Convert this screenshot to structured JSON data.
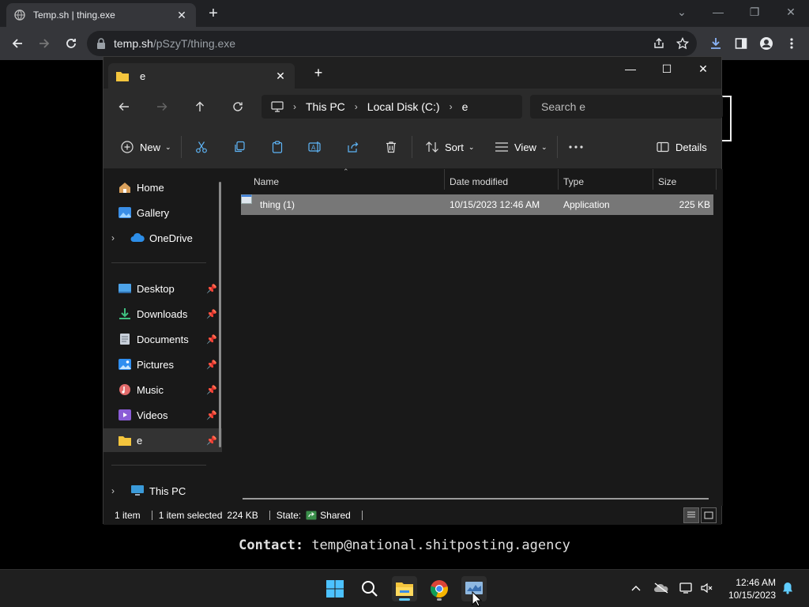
{
  "browser": {
    "tab_title": "Temp.sh | thing.exe",
    "url_host": "temp.sh",
    "url_path": "/pSzyT/thing.exe"
  },
  "page": {
    "contact_label": "Contact:",
    "contact_value": "temp@national.shitposting.agency"
  },
  "explorer": {
    "tab_label": "e",
    "breadcrumb": [
      "This PC",
      "Local Disk (C:)",
      "e"
    ],
    "search_placeholder": "Search e",
    "commands": {
      "new": "New",
      "sort": "Sort",
      "view": "View",
      "details": "Details"
    },
    "nav": {
      "home": "Home",
      "gallery": "Gallery",
      "onedrive": "OneDrive",
      "desktop": "Desktop",
      "downloads": "Downloads",
      "documents": "Documents",
      "pictures": "Pictures",
      "music": "Music",
      "videos": "Videos",
      "e": "e",
      "thispc": "This PC"
    },
    "columns": {
      "name": "Name",
      "date": "Date modified",
      "type": "Type",
      "size": "Size"
    },
    "files": [
      {
        "name": "thing (1)",
        "date": "10/15/2023 12:46 AM",
        "type": "Application",
        "size": "225 KB"
      }
    ],
    "status": {
      "count": "1 item",
      "selected": "1 item selected",
      "selected_size": "224 KB",
      "state_label": "State:",
      "state_value": "Shared"
    }
  },
  "taskbar": {
    "time": "12:46 AM",
    "date": "10/15/2023"
  },
  "colors": {
    "accent": "#60cdff",
    "selection": "#777777",
    "folder": "#f4c53d"
  }
}
